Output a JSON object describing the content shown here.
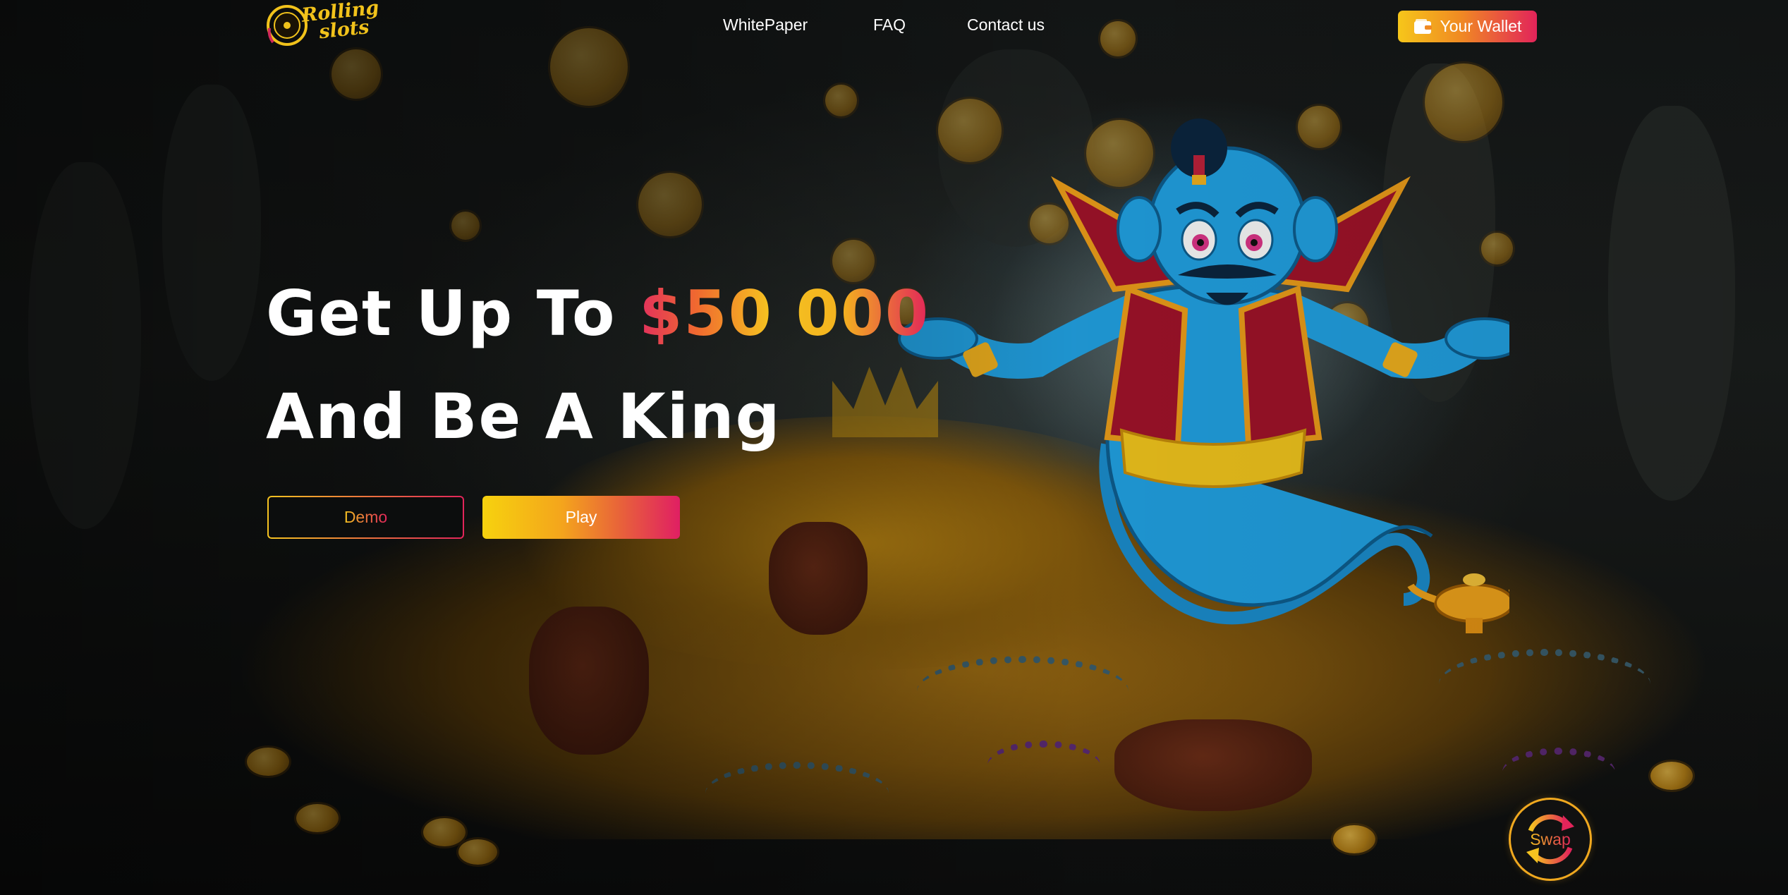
{
  "header": {
    "logo_text_line1": "Rolling",
    "logo_text_line2": "slots",
    "nav": [
      {
        "label": "WhitePaper"
      },
      {
        "label": "FAQ"
      },
      {
        "label": "Contact us"
      }
    ],
    "wallet_label": "Your Wallet"
  },
  "hero": {
    "line1_prefix": "Get Up To ",
    "line1_amount": "$50 000",
    "line2": "And Be A King",
    "demo_label": "Demo",
    "play_label": "Play"
  },
  "floating": {
    "swap_label": "Swap"
  },
  "colors": {
    "gradient_start": "#f5c320",
    "gradient_end": "#e2245a",
    "background": "#0f1112",
    "genie_blue": "#1ea5e6"
  },
  "icons": [
    "logo-mark-icon",
    "wallet-icon",
    "swap-arrows-icon"
  ]
}
